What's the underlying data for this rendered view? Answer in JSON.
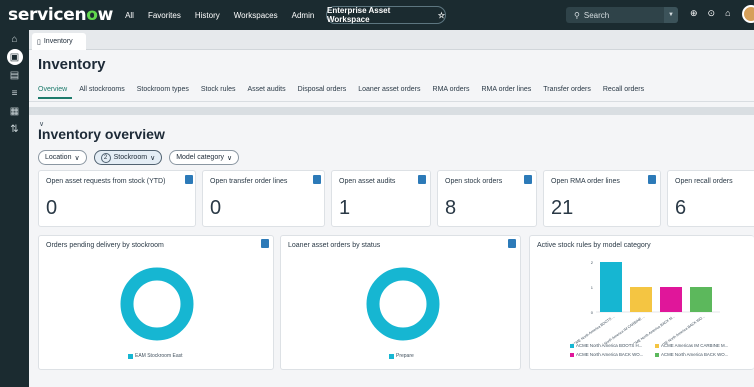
{
  "topnav": {
    "logo_pre": "servicen",
    "logo_o": "o",
    "logo_post": "w",
    "links": [
      "All",
      "Favorites",
      "History",
      "Workspaces",
      "Admin"
    ],
    "workspace": "Enterprise Asset Workspace",
    "search_placeholder": "Search"
  },
  "tab": {
    "label": "Inventory"
  },
  "page": {
    "title": "Inventory",
    "subtabs": [
      "Overview",
      "All stockrooms",
      "Stockroom types",
      "Stock rules",
      "Asset audits",
      "Disposal orders",
      "Loaner asset orders",
      "RMA orders",
      "RMA order lines",
      "Transfer orders",
      "Recall orders"
    ]
  },
  "overview": {
    "title": "Inventory overview",
    "filters": {
      "location": "Location",
      "stockroom_count": "2",
      "stockroom": "Stockroom",
      "model_category": "Model category"
    }
  },
  "kpis": [
    {
      "label": "Open asset requests from stock (YTD)",
      "value": "0"
    },
    {
      "label": "Open transfer order lines",
      "value": "0"
    },
    {
      "label": "Open asset audits",
      "value": "1"
    },
    {
      "label": "Open stock orders",
      "value": "8"
    },
    {
      "label": "Open RMA order lines",
      "value": "21"
    },
    {
      "label": "Open recall orders",
      "value": "6"
    }
  ],
  "widgets": {
    "pending": {
      "title": "Orders pending delivery by stockroom",
      "legend": "EAM Stockroom East"
    },
    "loaner": {
      "title": "Loaner asset orders by status",
      "legend": "Prepare"
    },
    "stockrules": {
      "title": "Active stock rules by model category"
    }
  },
  "chart_data": [
    {
      "type": "pie",
      "title": "Orders pending delivery by stockroom",
      "categories": [
        "EAM Stockroom East"
      ],
      "values": [
        1
      ],
      "colors": [
        "#16b6d2"
      ]
    },
    {
      "type": "pie",
      "title": "Loaner asset orders by status",
      "categories": [
        "Prepare"
      ],
      "values": [
        1
      ],
      "colors": [
        "#16b6d2"
      ]
    },
    {
      "type": "bar",
      "title": "Active stock rules by model category",
      "categories": [
        "ACME North America BOOTS ...",
        "ACME North America IM CARBINE ...",
        "ACME North America BACK M...",
        "ACME North America BACK WO..."
      ],
      "values": [
        2,
        1,
        1,
        1
      ],
      "colors": [
        "#16b6d2",
        "#f4c542",
        "#e0169a",
        "#5cb85c"
      ],
      "yticks": [
        "0",
        "1",
        "2"
      ],
      "ylim": [
        0,
        2
      ],
      "legend": [
        "ACME North America BOOTS H...",
        "ACME Americas IM CARBINE M...",
        "ACME North America BACK WO...",
        "ACME North America BACK WO..."
      ]
    }
  ],
  "colors": {
    "nav": "#1b2b30",
    "accent": "#1d7b6c",
    "donut": "#16b6d2",
    "badge": "#2c7ab8"
  }
}
